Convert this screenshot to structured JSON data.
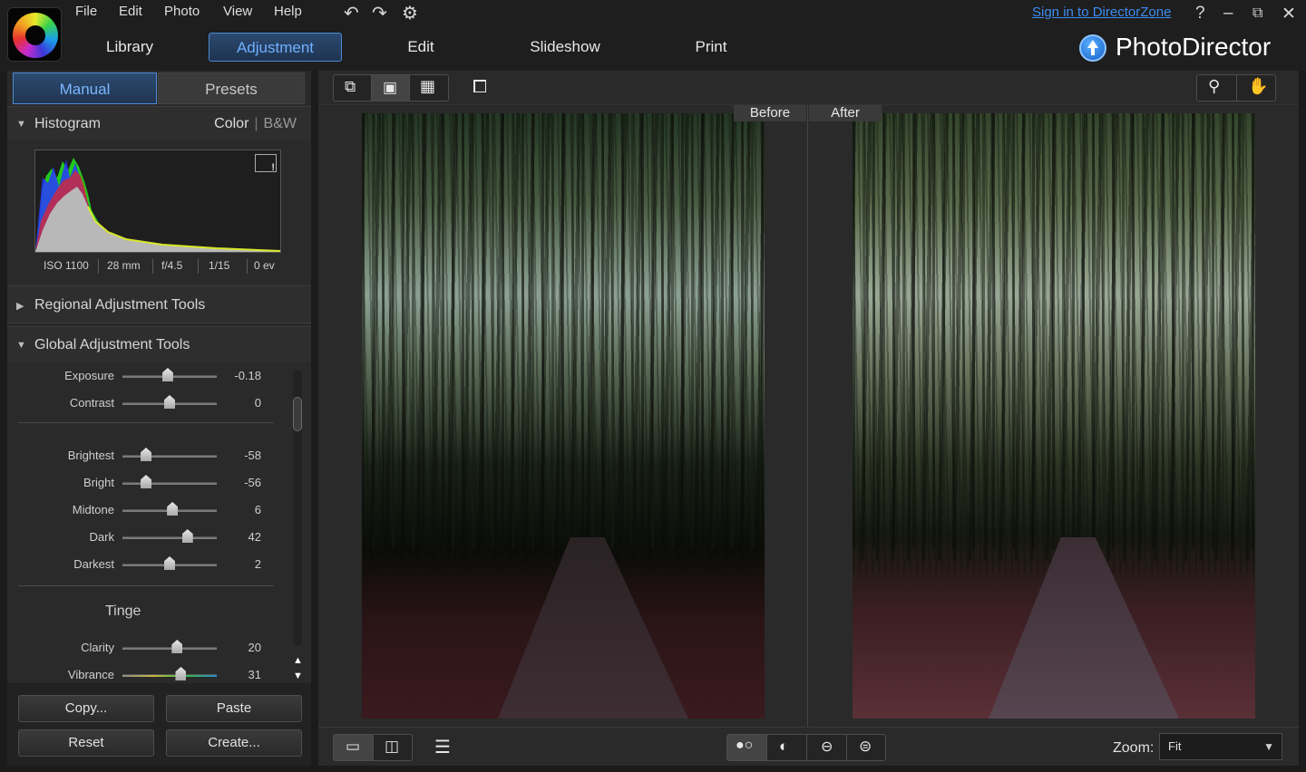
{
  "menu": [
    "File",
    "Edit",
    "Photo",
    "View",
    "Help"
  ],
  "toolbar_icons": [
    "undo-icon",
    "redo-icon",
    "settings-icon"
  ],
  "modules": [
    "Library",
    "Adjustment",
    "Edit",
    "Slideshow",
    "Print"
  ],
  "active_module": "Adjustment",
  "signin_link": "Sign in to DirectorZone",
  "window_controls": {
    "help": "?",
    "minimize": "–",
    "maximize": "⧉",
    "close": "✕"
  },
  "brand_name": "PhotoDirector",
  "left_panel": {
    "tabs": [
      "Manual",
      "Presets"
    ],
    "active_tab": "Manual",
    "histogram": {
      "title": "Histogram",
      "mode_color": "Color",
      "mode_bw": "B&W",
      "exif": [
        "ISO 1100",
        "28 mm",
        "f/4.5",
        "1/15",
        "0 ev"
      ]
    },
    "regional_title": "Regional Adjustment Tools",
    "global_title": "Global Adjustment Tools",
    "sliders": [
      {
        "label": "Exposure",
        "value": "-0.18",
        "position": 0.48
      },
      {
        "label": "Contrast",
        "value": "0",
        "position": 0.5
      },
      {
        "label": "Brightest",
        "value": "-58",
        "position": 0.25
      },
      {
        "label": "Bright",
        "value": "-56",
        "position": 0.25
      },
      {
        "label": "Midtone",
        "value": "6",
        "position": 0.53
      },
      {
        "label": "Dark",
        "value": "42",
        "position": 0.69
      },
      {
        "label": "Darkest",
        "value": "2",
        "position": 0.5
      },
      {
        "label": "Clarity",
        "value": "20",
        "position": 0.58
      },
      {
        "label": "Vibrance",
        "value": "31",
        "position": 0.62
      }
    ],
    "tinge_label": "Tinge",
    "buttons": {
      "copy": "Copy...",
      "paste": "Paste",
      "reset": "Reset",
      "create": "Create..."
    }
  },
  "viewer": {
    "before_label": "Before",
    "after_label": "After",
    "zoom_label": "Zoom:",
    "zoom_value": "Fit"
  },
  "colors": {
    "accent": "#4c8ad6",
    "accent_text": "#6fb0ff",
    "link": "#3d8cf0"
  }
}
